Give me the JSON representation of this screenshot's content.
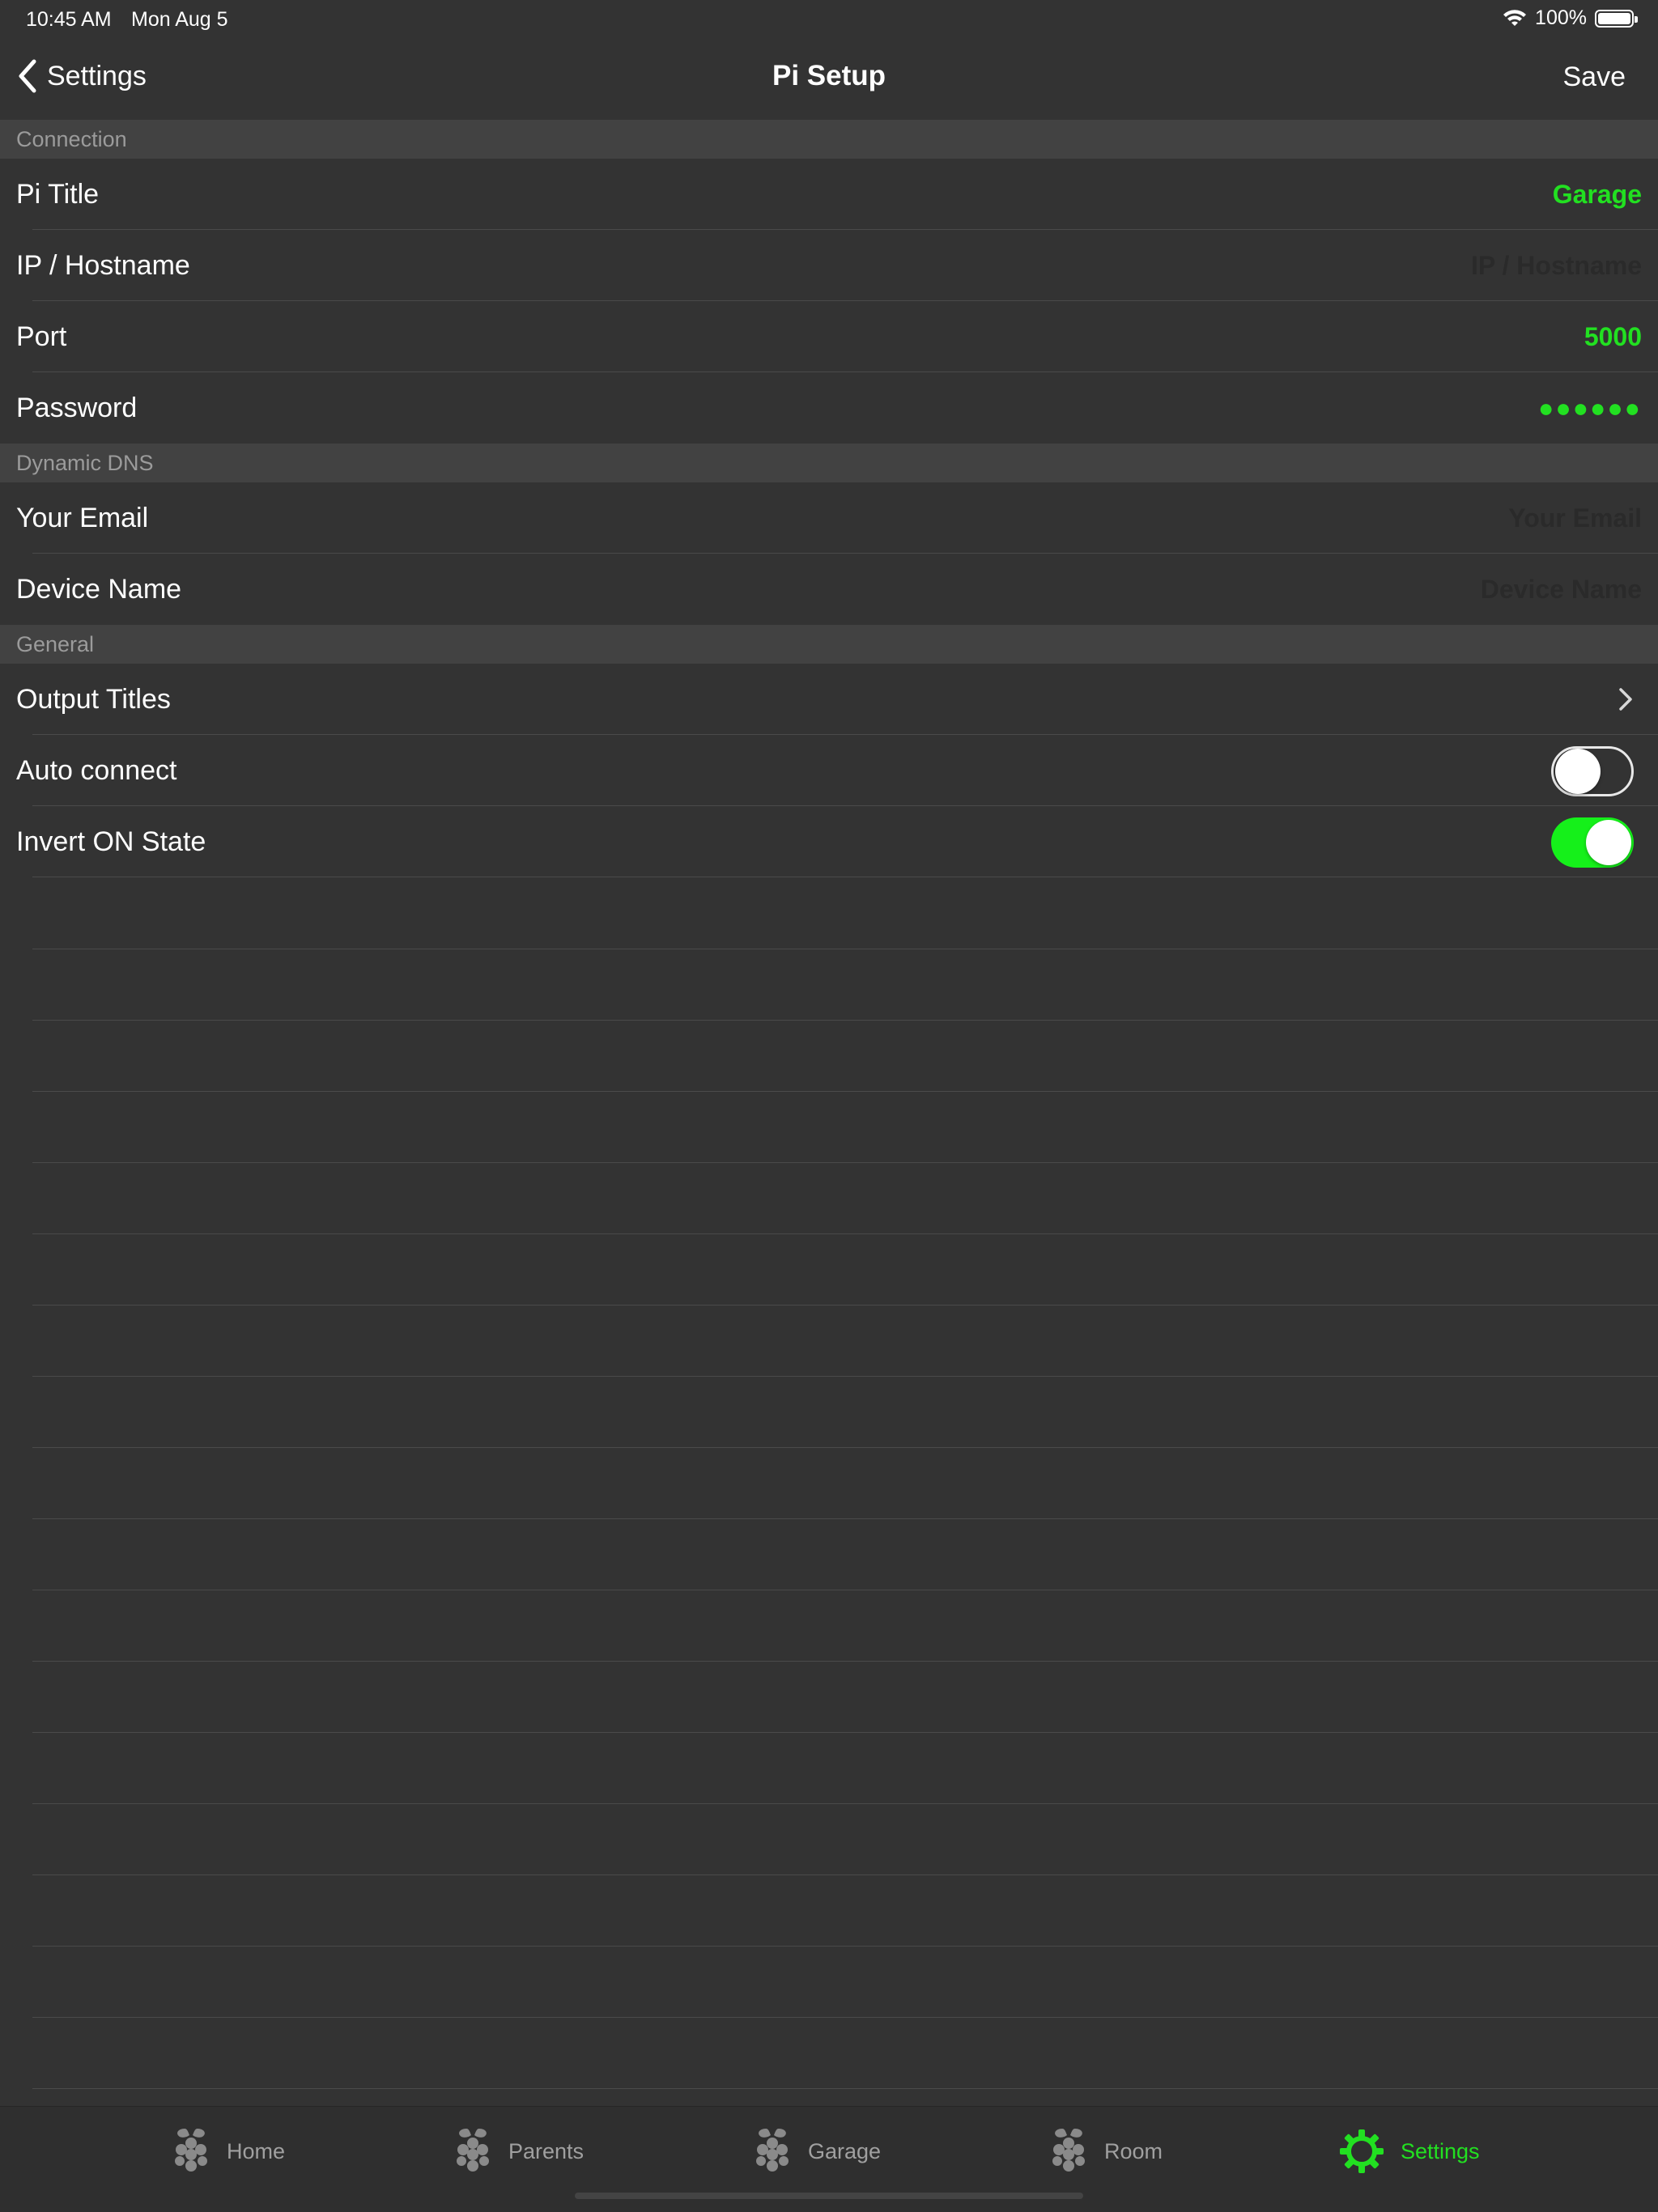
{
  "status_bar": {
    "time": "10:45 AM",
    "date": "Mon Aug 5",
    "battery": "100%"
  },
  "nav": {
    "back_label": "Settings",
    "title": "Pi Setup",
    "save_label": "Save"
  },
  "sections": {
    "connection": {
      "header": "Connection",
      "pi_title": {
        "label": "Pi Title",
        "value": "Garage"
      },
      "ip": {
        "label": "IP / Hostname",
        "placeholder": "IP / Hostname"
      },
      "port": {
        "label": "Port",
        "value": "5000"
      },
      "password": {
        "label": "Password",
        "value": "●●●●●●"
      }
    },
    "dynamic_dns": {
      "header": "Dynamic DNS",
      "email": {
        "label": "Your Email",
        "placeholder": "Your Email"
      },
      "device": {
        "label": "Device Name",
        "placeholder": "Device Name"
      }
    },
    "general": {
      "header": "General",
      "output_titles": {
        "label": "Output Titles"
      },
      "auto_connect": {
        "label": "Auto connect",
        "on": false
      },
      "invert_on": {
        "label": "Invert ON State",
        "on": true
      }
    }
  },
  "tabs": [
    {
      "label": "Home",
      "icon": "raspberry-icon"
    },
    {
      "label": "Parents",
      "icon": "raspberry-icon"
    },
    {
      "label": "Garage",
      "icon": "raspberry-icon"
    },
    {
      "label": "Room",
      "icon": "raspberry-icon"
    },
    {
      "label": "Settings",
      "icon": "gear-icon",
      "active": true
    }
  ],
  "colors": {
    "accent": "#22e021",
    "background": "#333333",
    "section_header": "#424242"
  }
}
